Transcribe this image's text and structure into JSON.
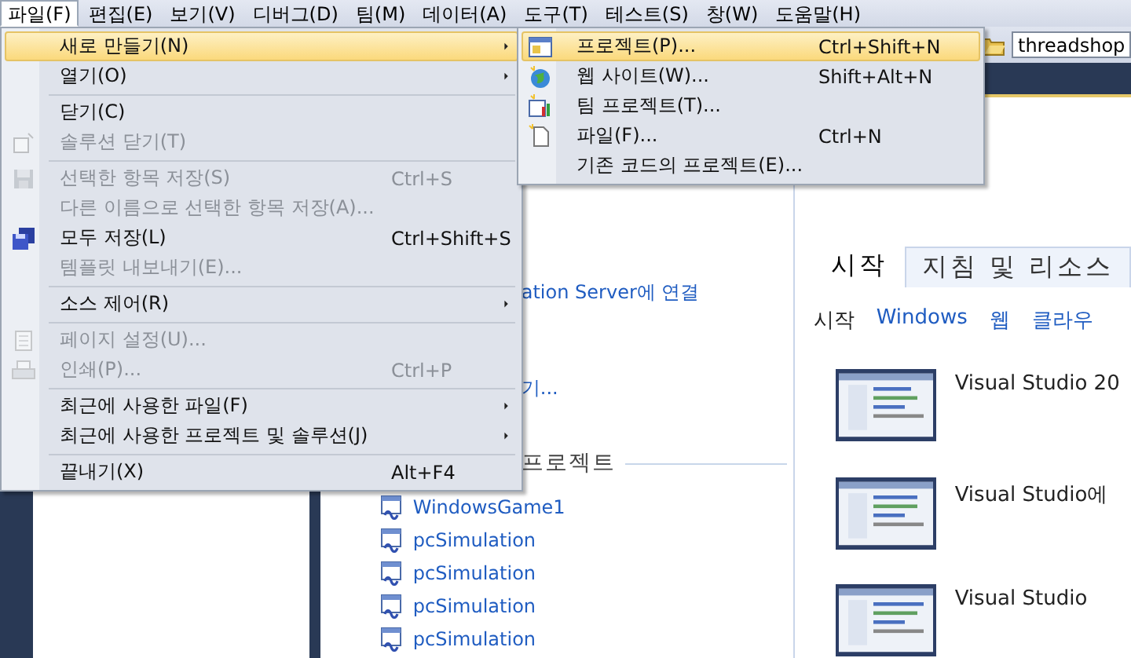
{
  "menubar": [
    {
      "label": "파일(F)",
      "selected": true
    },
    {
      "label": "편집(E)",
      "selected": false
    },
    {
      "label": "보기(V)",
      "selected": false
    },
    {
      "label": "디버그(D)",
      "selected": false
    },
    {
      "label": "팀(M)",
      "selected": false
    },
    {
      "label": "데이터(A)",
      "selected": false
    },
    {
      "label": "도구(T)",
      "selected": false
    },
    {
      "label": "테스트(S)",
      "selected": false
    },
    {
      "label": "창(W)",
      "selected": false
    },
    {
      "label": "도움말(H)",
      "selected": false
    }
  ],
  "toolbar": {
    "field": {
      "value": "threadshop"
    }
  },
  "file_menu": [
    {
      "kind": "item",
      "label": "새로 만들기(N)",
      "highlighted": true,
      "disabled": false,
      "submenu": true
    },
    {
      "kind": "item",
      "label": "열기(O)",
      "highlighted": false,
      "disabled": false,
      "submenu": true
    },
    {
      "kind": "separator"
    },
    {
      "kind": "item",
      "label": "닫기(C)",
      "highlighted": false,
      "disabled": false,
      "submenu": false
    },
    {
      "kind": "item",
      "label": "솔루션 닫기(T)",
      "highlighted": false,
      "disabled": true,
      "submenu": false
    },
    {
      "kind": "separator"
    },
    {
      "kind": "item",
      "label": "선택한 항목 저장(S)",
      "shortcut": "Ctrl+S",
      "highlighted": false,
      "disabled": true,
      "submenu": false
    },
    {
      "kind": "item",
      "label": "다른 이름으로 선택한 항목 저장(A)...",
      "highlighted": false,
      "disabled": true,
      "submenu": false
    },
    {
      "kind": "item",
      "label": "모두 저장(L)",
      "shortcut": "Ctrl+Shift+S",
      "highlighted": false,
      "disabled": false,
      "submenu": false
    },
    {
      "kind": "item",
      "label": "템플릿 내보내기(E)...",
      "highlighted": false,
      "disabled": true,
      "submenu": false
    },
    {
      "kind": "separator"
    },
    {
      "kind": "item",
      "label": "소스 제어(R)",
      "highlighted": false,
      "disabled": false,
      "submenu": true
    },
    {
      "kind": "separator"
    },
    {
      "kind": "item",
      "label": "페이지 설정(U)...",
      "highlighted": false,
      "disabled": true,
      "submenu": false
    },
    {
      "kind": "item",
      "label": "인쇄(P)...",
      "shortcut": "Ctrl+P",
      "highlighted": false,
      "disabled": true,
      "submenu": false
    },
    {
      "kind": "separator"
    },
    {
      "kind": "item",
      "label": "최근에 사용한 파일(F)",
      "highlighted": false,
      "disabled": false,
      "submenu": true
    },
    {
      "kind": "item",
      "label": "최근에 사용한 프로젝트 및 솔루션(J)",
      "highlighted": false,
      "disabled": false,
      "submenu": true
    },
    {
      "kind": "separator"
    },
    {
      "kind": "item",
      "label": "끝내기(X)",
      "shortcut": "Alt+F4",
      "highlighted": false,
      "disabled": false,
      "submenu": false
    }
  ],
  "new_submenu": [
    {
      "kind": "item",
      "label": "프로젝트(P)...",
      "shortcut": "Ctrl+Shift+N",
      "highlighted": true,
      "disabled": false,
      "submenu": false
    },
    {
      "kind": "item",
      "label": "웹 사이트(W)...",
      "shortcut": "Shift+Alt+N",
      "highlighted": false,
      "disabled": false,
      "submenu": false
    },
    {
      "kind": "item",
      "label": "팀 프로젝트(T)...",
      "highlighted": false,
      "disabled": false,
      "submenu": false
    },
    {
      "kind": "item",
      "label": "파일(F)...",
      "shortcut": "Ctrl+N",
      "highlighted": false,
      "disabled": false,
      "submenu": false
    },
    {
      "kind": "item",
      "label": "기존 코드의 프로젝트(E)...",
      "highlighted": false,
      "disabled": false,
      "submenu": false
    }
  ],
  "start_page": {
    "links": [
      "ation Server에 연결",
      "기..."
    ],
    "recent_heading": "프로젝트",
    "recent_projects": [
      "WindowsGame1",
      "pcSimulation",
      "pcSimulation",
      "pcSimulation",
      "pcSimulation"
    ],
    "tabs": [
      {
        "label": "시작",
        "selected": true
      },
      {
        "label": "지침 및 리소스",
        "selected": false
      }
    ],
    "subtabs": [
      {
        "label": "시작",
        "selected": true
      },
      {
        "label": "Windows",
        "selected": false
      },
      {
        "label": "웹",
        "selected": false
      },
      {
        "label": "클라우",
        "selected": false
      }
    ],
    "articles": [
      "Visual Studio 20",
      "Visual Studio에",
      "Visual Studio"
    ]
  }
}
